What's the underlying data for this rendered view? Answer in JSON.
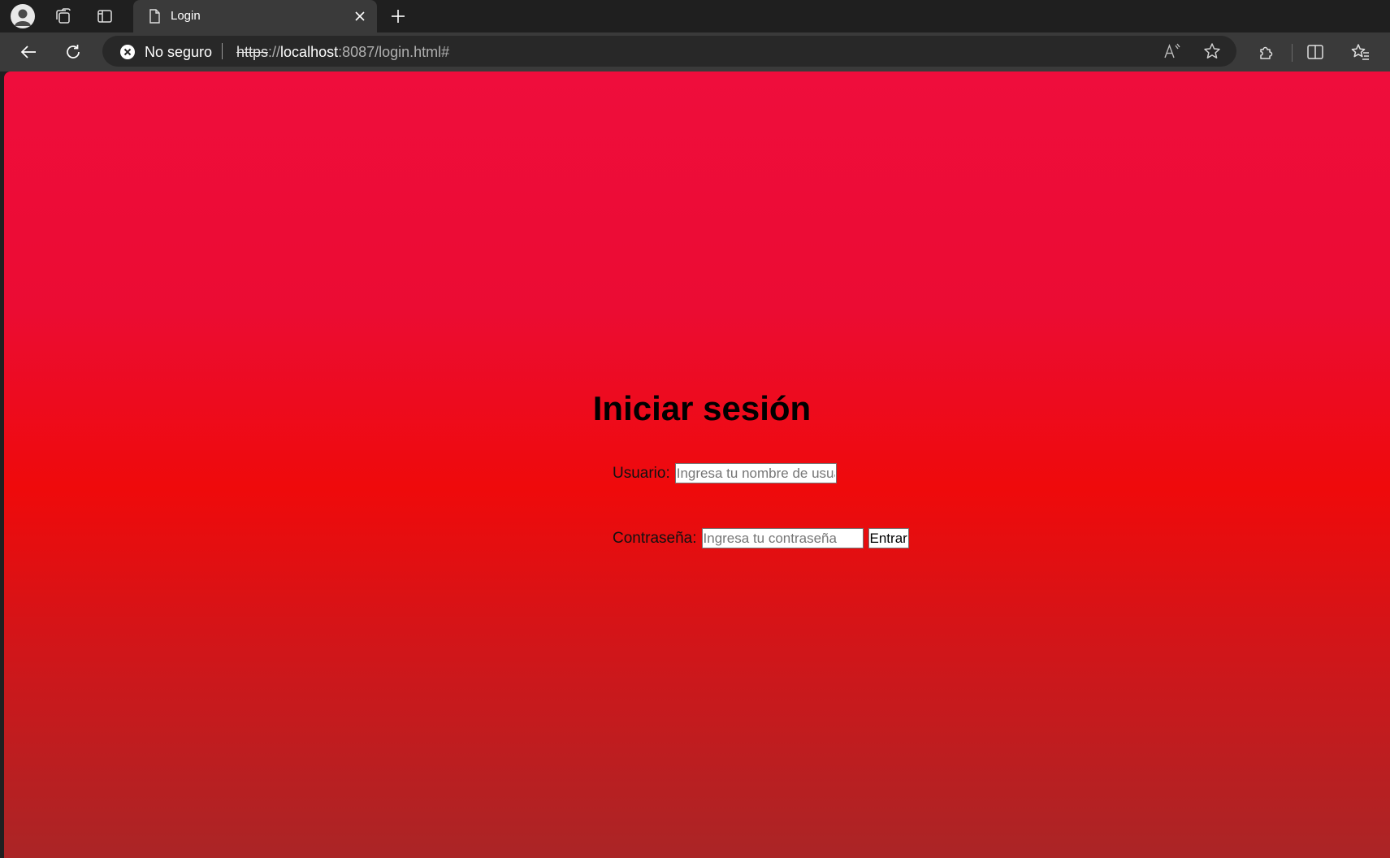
{
  "browser": {
    "tab": {
      "title": "Login"
    },
    "address": {
      "security_label": "No seguro",
      "url_scheme": "https",
      "url_separator": "://",
      "url_host": "localhost",
      "url_rest": ":8087/login.html#"
    },
    "icons": {
      "profile": "profile-icon",
      "workspaces": "workspaces-icon",
      "tab_actions": "tab-actions-icon",
      "page": "page-icon",
      "close": "close-icon",
      "new_tab": "plus-icon",
      "back": "back-arrow-icon",
      "reload": "reload-icon",
      "not_secure": "not-secure-icon",
      "read_aloud": "read-aloud-icon",
      "favorite": "star-icon",
      "extensions": "extensions-icon",
      "split_screen": "split-screen-icon",
      "favorites": "favorites-icon"
    }
  },
  "page": {
    "title": "Iniciar sesión",
    "username": {
      "label": "Usuario:",
      "placeholder": "Ingresa tu nombre de usuario",
      "value": ""
    },
    "password": {
      "label": "Contraseña:",
      "placeholder": "Ingresa tu contraseña",
      "value": ""
    },
    "submit_label": "Entrar",
    "colors": {
      "gradient_top": "#ef0d3c",
      "gradient_mid": "#ef0a0b",
      "gradient_bottom": "#aa2526"
    }
  }
}
